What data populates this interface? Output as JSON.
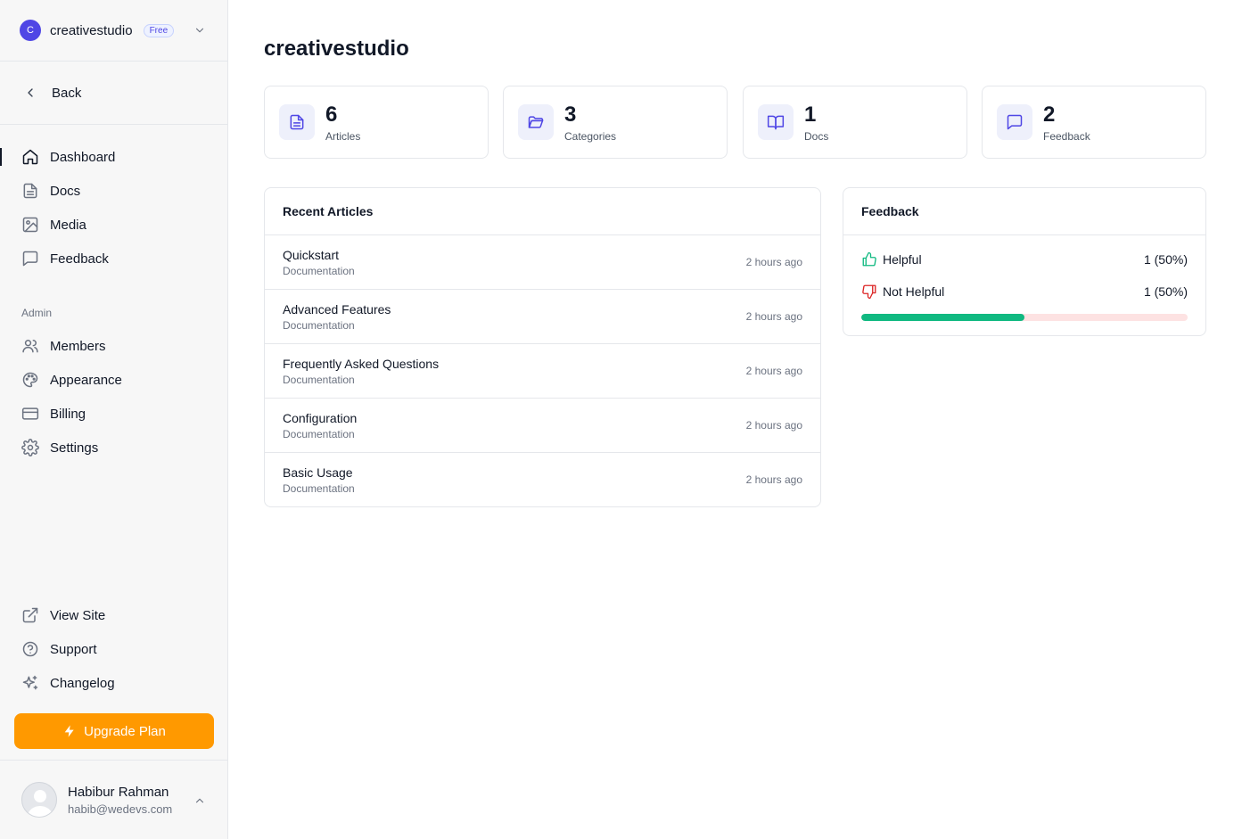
{
  "workspace": {
    "initial": "C",
    "name": "creativestudio",
    "plan_badge": "Free"
  },
  "nav": {
    "back_label": "Back",
    "main_items": [
      {
        "label": "Dashboard",
        "icon": "home-icon"
      },
      {
        "label": "Docs",
        "icon": "document-icon"
      },
      {
        "label": "Media",
        "icon": "image-icon"
      },
      {
        "label": "Feedback",
        "icon": "message-icon"
      }
    ],
    "admin_label": "Admin",
    "admin_items": [
      {
        "label": "Members",
        "icon": "users-icon"
      },
      {
        "label": "Appearance",
        "icon": "palette-icon"
      },
      {
        "label": "Billing",
        "icon": "credit-card-icon"
      },
      {
        "label": "Settings",
        "icon": "gear-icon"
      }
    ],
    "footer_items": [
      {
        "label": "View Site",
        "icon": "external-link-icon"
      },
      {
        "label": "Support",
        "icon": "help-circle-icon"
      },
      {
        "label": "Changelog",
        "icon": "sparkles-icon"
      }
    ],
    "upgrade_label": "Upgrade Plan"
  },
  "user": {
    "name": "Habibur Rahman",
    "email": "habib@wedevs.com"
  },
  "page": {
    "title": "creativestudio"
  },
  "stats": [
    {
      "value": "6",
      "label": "Articles"
    },
    {
      "value": "3",
      "label": "Categories"
    },
    {
      "value": "1",
      "label": "Docs"
    },
    {
      "value": "2",
      "label": "Feedback"
    }
  ],
  "recent_articles": {
    "title": "Recent Articles",
    "items": [
      {
        "title": "Quickstart",
        "doc": "Documentation",
        "time": "2 hours ago"
      },
      {
        "title": "Advanced Features",
        "doc": "Documentation",
        "time": "2 hours ago"
      },
      {
        "title": "Frequently Asked Questions",
        "doc": "Documentation",
        "time": "2 hours ago"
      },
      {
        "title": "Configuration",
        "doc": "Documentation",
        "time": "2 hours ago"
      },
      {
        "title": "Basic Usage",
        "doc": "Documentation",
        "time": "2 hours ago"
      }
    ]
  },
  "feedback": {
    "title": "Feedback",
    "helpful_label": "Helpful",
    "helpful_value": "1 (50%)",
    "not_helpful_label": "Not Helpful",
    "not_helpful_value": "1 (50%)",
    "helpful_fraction": 0.5
  },
  "colors": {
    "accent": "#4f46e5",
    "upgrade": "#ff9900",
    "helpful": "#10b981",
    "not_helpful": "#dc2626",
    "not_helpful_track": "#fde2e2"
  }
}
